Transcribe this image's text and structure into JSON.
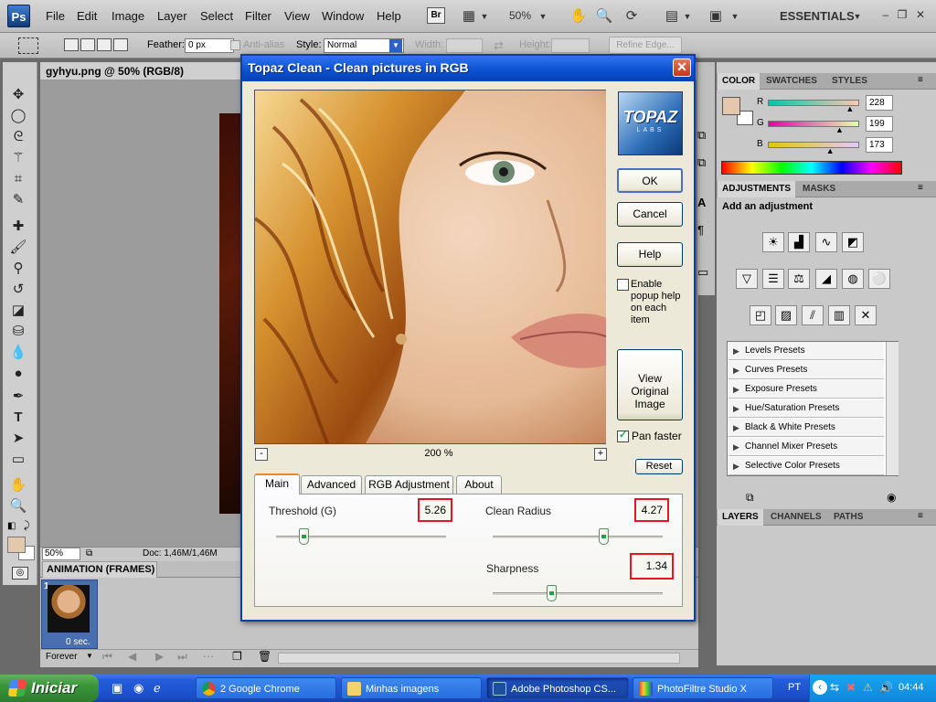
{
  "app": {
    "logo": "Ps",
    "menus": [
      "File",
      "Edit",
      "Image",
      "Layer",
      "Select",
      "Filter",
      "View",
      "Window",
      "Help"
    ],
    "bridge_label": "Br",
    "zoom": "50%",
    "workspace": "ESSENTIALS"
  },
  "options": {
    "feather_label": "Feather:",
    "feather_value": "0 px",
    "antialias_label": "Anti-alias",
    "style_label": "Style:",
    "style_value": "Normal",
    "width_label": "Width:",
    "height_label": "Height:",
    "refine_edge": "Refine Edge..."
  },
  "document": {
    "tab_title": "gyhyu.png @ 50% (RGB/8)",
    "zoom": "50%",
    "doc_size": "Doc: 1,46M/1,46M"
  },
  "animation": {
    "panel_title": "ANIMATION (FRAMES)",
    "frame_number": "1",
    "frame_delay": "0 sec.",
    "loop": "Forever"
  },
  "color_panel": {
    "tabs": [
      "COLOR",
      "SWATCHES",
      "STYLES"
    ],
    "r_label": "R",
    "r": "228",
    "g_label": "G",
    "g": "199",
    "b_label": "B",
    "b": "173",
    "r_level": 0.894,
    "g_level": 0.78,
    "b_level": 0.678,
    "fg_color": "#e4c7ad"
  },
  "adjustments": {
    "tabs": [
      "ADJUSTMENTS",
      "MASKS"
    ],
    "heading": "Add an adjustment",
    "presets": [
      "Levels Presets",
      "Curves Presets",
      "Exposure Presets",
      "Hue/Saturation Presets",
      "Black & White Presets",
      "Channel Mixer Presets",
      "Selective Color Presets"
    ]
  },
  "layers_panel": {
    "tabs": [
      "LAYERS",
      "CHANNELS",
      "PATHS"
    ]
  },
  "dialog": {
    "title": "Topaz Clean - Clean pictures in RGB",
    "ok": "OK",
    "cancel": "Cancel",
    "help": "Help",
    "popup_help": "Enable popup help on each item",
    "view_original": "View Original Image",
    "pan_faster": "Pan faster",
    "zoom_value": "200 %",
    "zoom_minus": "-",
    "zoom_plus": "+",
    "reset": "Reset",
    "logo_main": "TOPAZ",
    "logo_sub": "LABS",
    "tabs": [
      "Main",
      "Advanced",
      "RGB Adjustment",
      "About"
    ],
    "threshold_label": "Threshold (G)",
    "threshold_value": "5.26",
    "clean_radius_label": "Clean Radius",
    "clean_radius_value": "4.27",
    "sharpness_label": "Sharpness",
    "sharpness_value": "1.34"
  },
  "taskbar": {
    "start": "Iniciar",
    "tasks": [
      "2 Google Chrome",
      "Minhas imagens",
      "Adobe Photoshop CS...",
      "PhotoFiltre Studio X"
    ],
    "lang": "PT",
    "clock": "04:44"
  }
}
